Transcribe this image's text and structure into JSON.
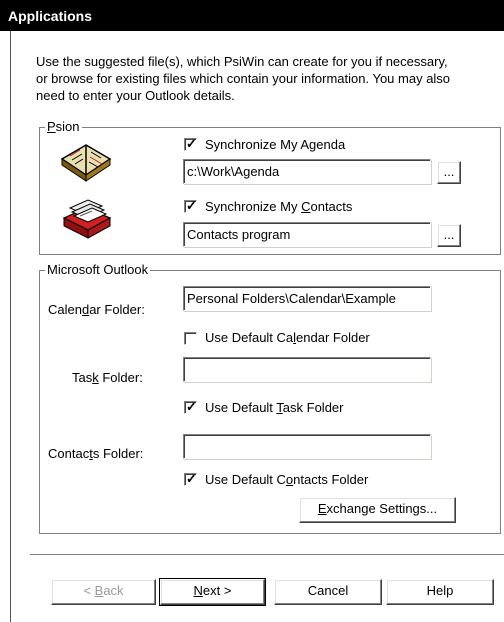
{
  "title": "Applications",
  "intro": "Use the suggested file(s), which PsiWin can create for you if necessary, or browse for existing files which contain your information. You may also need to enter your Outlook details.",
  "psion": {
    "legend_prefix": "",
    "legend_accel": "P",
    "legend_rest": "sion",
    "agenda": {
      "checkbox_pre": "Synchronize My A",
      "checkbox_accel": "g",
      "checkbox_post": "enda",
      "checked": true,
      "path": "c:\\Work\\Agenda",
      "browse": "..."
    },
    "contacts": {
      "checkbox_pre": "Synchronize My ",
      "checkbox_accel": "C",
      "checkbox_post": "ontacts",
      "checked": true,
      "path": "Contacts program",
      "browse": "..."
    }
  },
  "outlook": {
    "legend": "Microsoft Outlook",
    "calendar": {
      "label_pre": "Calen",
      "label_accel": "d",
      "label_post": "ar Folder:",
      "value": "Personal Folders\\Calendar\\Example",
      "default_pre": "Use Default Ca",
      "default_accel": "l",
      "default_post": "endar Folder",
      "default_checked": false
    },
    "task": {
      "label_pre": "Tas",
      "label_accel": "k",
      "label_post": " Folder:",
      "value": "",
      "default_pre": "Use Default ",
      "default_accel": "T",
      "default_post": "ask Folder",
      "default_checked": true
    },
    "contacts": {
      "label_pre": "Contac",
      "label_accel": "t",
      "label_post": "s Folder:",
      "value": "",
      "default_pre": "Use Default C",
      "default_accel": "o",
      "default_post": "ntacts Folder",
      "default_checked": true
    },
    "exchange": {
      "pre": "",
      "accel": "E",
      "post": "xchange Settings..."
    }
  },
  "footer": {
    "back": {
      "pre": "< ",
      "accel": "B",
      "post": "ack"
    },
    "next": {
      "accel": "N",
      "post": "ext >"
    },
    "cancel": "Cancel",
    "help": "Help"
  }
}
